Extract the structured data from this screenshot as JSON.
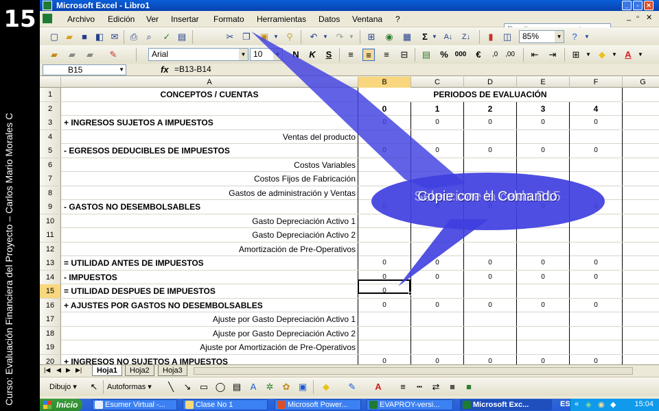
{
  "slide": {
    "number": "15",
    "caption": "Curso: Evaluación Financiera del Proyecto – Carlos Mario Morales C"
  },
  "window": {
    "title": "Microsoft Excel - Libro1"
  },
  "menu": [
    "Archivo",
    "Edición",
    "Ver",
    "Insertar",
    "Formato",
    "Herramientas",
    "Datos",
    "Ventana",
    "?"
  ],
  "help_box": {
    "placeholder": "Escriba una pregunta"
  },
  "toolbar": {
    "zoom": "85%",
    "font": "Arial",
    "font_size": "10",
    "bold_label": "N",
    "italic_label": "K",
    "underline_label": "S"
  },
  "formula_bar": {
    "name_box": "B15",
    "fx_label": "fx",
    "formula": "=B13-B14"
  },
  "columns": [
    "A",
    "B",
    "C",
    "D",
    "E",
    "F",
    "G"
  ],
  "header_rows": {
    "r1_a": "CONCEPTOS / CUENTAS",
    "r1_bf": "PERIODOS DE EVALUACIÓN",
    "r2_periods": [
      "0",
      "1",
      "2",
      "3",
      "4"
    ]
  },
  "rows": [
    {
      "n": "3",
      "label": "+  INGRESOS SUJETOS A IMPUESTOS",
      "style": "bold-left",
      "values": [
        "0",
        "0",
        "0",
        "0",
        "0"
      ]
    },
    {
      "n": "4",
      "label": "Ventas del producto",
      "style": "right",
      "values": [
        "",
        "",
        "",
        "",
        ""
      ]
    },
    {
      "n": "5",
      "label": "-  EGRESOS DEDUCIBLES DE IMPUESTOS",
      "style": "bold-left",
      "values": [
        "0",
        "0",
        "0",
        "0",
        "0"
      ]
    },
    {
      "n": "6",
      "label": "Costos Variables",
      "style": "right",
      "values": [
        "",
        "",
        "",
        "",
        ""
      ]
    },
    {
      "n": "7",
      "label": "Costos Fijos de Fabricación",
      "style": "right",
      "values": [
        "",
        "",
        "",
        "",
        ""
      ]
    },
    {
      "n": "8",
      "label": "Gastos de administración y Ventas",
      "style": "right",
      "values": [
        "",
        "",
        "",
        "",
        ""
      ]
    },
    {
      "n": "9",
      "label": "- GASTOS NO DESEMBOLSABLES",
      "style": "bold-left",
      "values": [
        "0",
        "0",
        "0",
        "0",
        "0"
      ]
    },
    {
      "n": "10",
      "label": "Gasto Depreciación Activo 1",
      "style": "right",
      "values": [
        "",
        "",
        "",
        "",
        ""
      ]
    },
    {
      "n": "11",
      "label": "Gasto Depreciación Activo 2",
      "style": "right",
      "values": [
        "",
        "",
        "",
        "",
        ""
      ]
    },
    {
      "n": "12",
      "label": "Amortización de Pre-Operativos",
      "style": "right",
      "values": [
        "",
        "",
        "",
        "",
        ""
      ]
    },
    {
      "n": "13",
      "label": "= UTILIDAD ANTES DE IMPUESTOS",
      "style": "bold-left",
      "values": [
        "0",
        "0",
        "0",
        "0",
        "0"
      ]
    },
    {
      "n": "14",
      "label": "- IMPUESTOS",
      "style": "bold-left",
      "values": [
        "0",
        "0",
        "0",
        "0",
        "0"
      ]
    },
    {
      "n": "15",
      "label": "= UTILIDAD DESPUES DE IMPUESTOS",
      "style": "bold-left",
      "values": [
        "0",
        "",
        "",
        "",
        ""
      ]
    },
    {
      "n": "16",
      "label": "+ AJUSTES POR GASTOS NO DESEMBOLSABLES",
      "style": "bold-left",
      "values": [
        "0",
        "0",
        "0",
        "0",
        "0"
      ]
    },
    {
      "n": "17",
      "label": "Ajuste por Gasto Depreciación Activo 1",
      "style": "right",
      "values": [
        "",
        "",
        "",
        "",
        ""
      ]
    },
    {
      "n": "18",
      "label": "Ajuste por Gasto Depreciación Activo 2",
      "style": "right",
      "values": [
        "",
        "",
        "",
        "",
        ""
      ]
    },
    {
      "n": "19",
      "label": "Ajuste por Amortización de Pre-Operativos",
      "style": "right",
      "values": [
        "",
        "",
        "",
        "",
        ""
      ]
    },
    {
      "n": "20",
      "label": "+ INGRESOS NO SUJETOS A IMPUESTOS",
      "style": "bold-left",
      "values": [
        "0",
        "0",
        "0",
        "0",
        "0"
      ]
    }
  ],
  "sheets": [
    "Hoja1",
    "Hoja2",
    "Hoja3"
  ],
  "draw_toolbar": {
    "draw_label": "Dibujo ▾",
    "autoshapes_label": "Autoformas ▾"
  },
  "taskbar": {
    "start_label": "Inicio",
    "buttons": [
      "Esumer Virtual -...",
      "Clase No 1",
      "Microsoft Power...",
      "EVAPROY-versi...",
      "Microsoft Exc..."
    ],
    "clock": "15:04"
  },
  "callout": {
    "text": "Copie con el Comando",
    "ghost_text": "Seleccione la celda B15",
    "fill": "#3F3FE0"
  }
}
